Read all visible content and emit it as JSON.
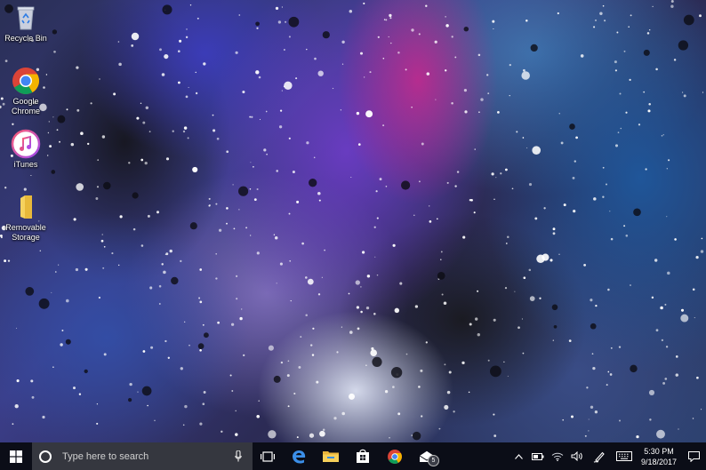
{
  "desktop": {
    "icons": [
      {
        "label": "Recycle Bin",
        "icon": "recycle-bin-icon"
      },
      {
        "label": "Google Chrome",
        "icon": "chrome-icon"
      },
      {
        "label": "iTunes",
        "icon": "itunes-icon"
      },
      {
        "label": "Removable Storage",
        "icon": "folder-icon"
      }
    ]
  },
  "taskbar": {
    "start_icon": "windows-logo-icon",
    "search": {
      "placeholder": "Type here to search"
    },
    "pinned": [
      {
        "name": "task-view",
        "icon": "task-view-icon"
      },
      {
        "name": "edge",
        "icon": "edge-icon"
      },
      {
        "name": "file-explorer",
        "icon": "folder-icon"
      },
      {
        "name": "store",
        "icon": "store-icon"
      },
      {
        "name": "chrome",
        "icon": "chrome-icon"
      },
      {
        "name": "mail",
        "icon": "mail-icon",
        "badge": "5"
      }
    ],
    "tray": {
      "icons": [
        "chevron-up-icon",
        "battery-icon",
        "wifi-icon",
        "volume-icon",
        "pen-icon",
        "keyboard-icon"
      ],
      "time": "5:30 PM",
      "date": "9/18/2017",
      "notification_icon": "action-center-icon"
    }
  },
  "colors": {
    "taskbar_bg": "#0b0d17",
    "search_bg": "#35373f",
    "accent": "#7ab0ff"
  }
}
